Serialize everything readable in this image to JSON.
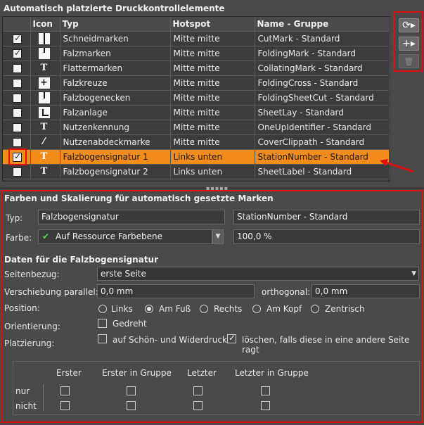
{
  "top": {
    "title": "Automatisch platzierte Druckkontrollelemente",
    "columns": [
      "",
      "Icon",
      "Typ",
      "Hotspot",
      "Name - Gruppe"
    ],
    "rows": [
      {
        "checked": true,
        "icon": "cut-mark-icon",
        "glyph": "",
        "type": "Schneidmarken",
        "hotspot": "Mitte mitte",
        "name": "CutMark - Standard"
      },
      {
        "checked": true,
        "icon": "fold-mark-icon",
        "glyph": "",
        "type": "Falzmarken",
        "hotspot": "Mitte mitte",
        "name": "FoldingMark - Standard"
      },
      {
        "checked": false,
        "icon": "text-icon",
        "glyph": "T",
        "type": "Flattermarken",
        "hotspot": "Mitte mitte",
        "name": "CollatingMark - Standard"
      },
      {
        "checked": false,
        "icon": "cross-mark-icon",
        "glyph": "",
        "type": "Falzkreuze",
        "hotspot": "Mitte mitte",
        "name": "FoldingCross - Standard"
      },
      {
        "checked": false,
        "icon": "sheet-corner-icon",
        "glyph": "",
        "type": "Falzbogenecken",
        "hotspot": "Mitte mitte",
        "name": "FoldingSheetCut - Standard"
      },
      {
        "checked": false,
        "icon": "sheet-lay-icon",
        "glyph": "",
        "type": "Falzanlage",
        "hotspot": "Mitte mitte",
        "name": "SheetLay - Standard"
      },
      {
        "checked": false,
        "icon": "text-icon",
        "glyph": "T",
        "type": "Nutzenkennung",
        "hotspot": "Mitte mitte",
        "name": "OneUpIdentifier - Standard"
      },
      {
        "checked": false,
        "icon": "wand-icon",
        "glyph": "⁄",
        "type": "Nutzenabdeckmarke",
        "hotspot": "Mitte mitte",
        "name": "CoverClippath - Standard"
      },
      {
        "checked": true,
        "icon": "text-icon",
        "glyph": "T",
        "type": "Falzbogensignatur 1",
        "hotspot": "Links unten",
        "name": "StationNumber - Standard",
        "selected": true
      },
      {
        "checked": false,
        "icon": "text-icon",
        "glyph": "T",
        "type": "Falzbogensignatur 2",
        "hotspot": "Links unten",
        "name": "SheetLabel - Standard"
      }
    ]
  },
  "side_buttons": [
    {
      "name": "refresh-button",
      "icon": "refresh-icon",
      "glyph": "⟳▸"
    },
    {
      "name": "add-button",
      "icon": "plus-icon",
      "glyph": "+▸"
    },
    {
      "name": "delete-button",
      "icon": "trash-icon",
      "glyph": "🗑",
      "disabled": true
    }
  ],
  "bottom": {
    "title": "Farben und Skalierung für automatisch gesetzte Marken",
    "typ_label": "Typ:",
    "typ_value": "Falzbogensignatur",
    "typ_name": "StationNumber - Standard",
    "farbe_label": "Farbe:",
    "farbe_value": "Auf Ressource Farbebene",
    "farbe_percent": "100,0 %",
    "data_title": "Daten für die Falzbogensignatur",
    "seitenbezug_label": "Seitenbezug:",
    "seitenbezug_value": "erste Seite",
    "verschiebung_label": "Verschiebung parallel:",
    "verschiebung_value": "0,0 mm",
    "orthogonal_label": "orthogonal:",
    "orthogonal_value": "0,0 mm",
    "position_label": "Position:",
    "position_options": [
      "Links",
      "Am Fuß",
      "Rechts",
      "Am Kopf",
      "Zentrisch"
    ],
    "position_selected": "Am Fuß",
    "orientierung_label": "Orientierung:",
    "gedreht_label": "Gedreht",
    "gedreht_checked": false,
    "platzierung_label": "Platzierung:",
    "schoen_label": "auf Schön- und Widerdruck",
    "schoen_checked": false,
    "loeschen_label": "löschen, falls diese in eine andere Seite ragt",
    "loeschen_checked": true,
    "grid_columns": [
      "Erster",
      "Erster in Gruppe",
      "Letzter",
      "Letzter in Gruppe"
    ],
    "grid_rows": [
      "nur",
      "nicht"
    ]
  },
  "colors": {
    "selection": "#f08b1c",
    "highlight_red": "#e01010"
  }
}
